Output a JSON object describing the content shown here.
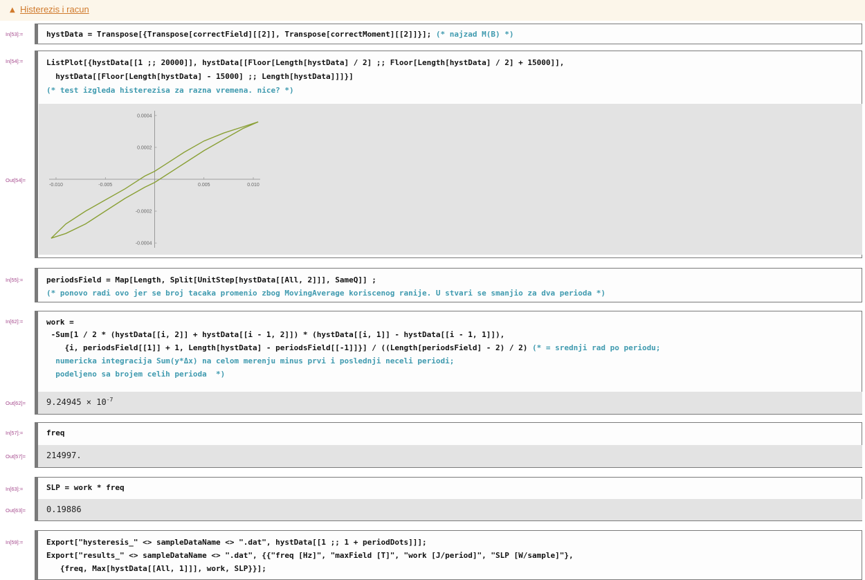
{
  "section": {
    "title": "Histerezis i racun"
  },
  "cells": {
    "c53": {
      "in_label": "In[53]:=",
      "line1": "hystData = Transpose[{Transpose[correctField][[2]], Transpose[correctMoment][[2]]}]; ",
      "comment": "(* najzad M(B) *)"
    },
    "c54": {
      "in_label": "In[54]:=",
      "out_label": "Out[54]=",
      "line1": "ListPlot[{hystData[[1 ;; 20000]], hystData[[Floor[Length[hystData] / 2] ;; Floor[Length[hystData] / 2] + 15000]],",
      "line2": "  hystData[[Floor[Length[hystData] - 15000] ;; Length[hystData]]]}]",
      "comment": "(* test izgleda histerezisa za razna vremena. nice? *)"
    },
    "c55": {
      "in_label": "In[55]:=",
      "line1": "periodsField = Map[Length, Split[UnitStep[hystData[[All, 2]]], SameQ]] ;",
      "comment": "(* ponovo radi ovo jer se broj tacaka promenio zbog MovingAverage koriscenog ranije. U stvari se smanjio za dva perioda *)"
    },
    "c62": {
      "in_label": "In[62]:=",
      "out_label": "Out[62]=",
      "line1": "work =",
      "line2": " -Sum[1 / 2 * (hystData[[i, 2]] + hystData[[i - 1, 2]]) * (hystData[[i, 1]] - hystData[[i - 1, 1]]),",
      "line3": "    {i, periodsField[[1]] + 1, Length[hystData] - periodsField[[-1]]}] / ((Length[periodsField] - 2) / 2) ",
      "line3_comment": "(* = srednji rad po periodu;",
      "line4": "  numericka integracija Sum(y*Δx) na celom merenju minus prvi i poslednji neceli periodi;",
      "line5": "  podeljeno sa brojem celih perioda  *)",
      "out_mantissa": "9.24945 × 10",
      "out_exp": "-7"
    },
    "c57": {
      "in_label": "In[57]:=",
      "out_label": "Out[57]=",
      "line1": "freq",
      "out": "214997."
    },
    "c63": {
      "in_label": "In[63]:=",
      "out_label": "Out[63]=",
      "line1": "SLP = work * freq",
      "out": "0.19886"
    },
    "c59": {
      "in_label": "In[59]:=",
      "line1": "Export[\"hysteresis_\" <> sampleDataName <> \".dat\", hystData[[1 ;; 1 + periodDots]]];",
      "line2": "Export[\"results_\" <> sampleDataName <> \".dat\", {{\"freq [Hz]\", \"maxField [T]\", \"work [J/period]\", \"SLP [W/sample]\"},",
      "line3": "   {freq, Max[hystData[[All, 1]]], work, SLP}}];"
    }
  },
  "chart_data": {
    "type": "scatter",
    "x_ticks": [
      "-0.010",
      "-0.005",
      "0.005",
      "0.010"
    ],
    "y_ticks": [
      "0.0004",
      "0.0002",
      "-0.0002",
      "-0.0004"
    ],
    "xlim": [
      -0.0107,
      0.0107
    ],
    "ylim": [
      -0.00043,
      0.00043
    ],
    "color": "#8aa036",
    "series": [
      {
        "x": [
          -0.0105,
          -0.009,
          -0.007,
          -0.005,
          -0.003,
          -0.001,
          0.0,
          0.001,
          0.003,
          0.005,
          0.007,
          0.009,
          0.0105
        ],
        "y": [
          -0.00037,
          -0.00034,
          -0.00028,
          -0.0002,
          -0.00012,
          -5e-05,
          -2e-05,
          2e-05,
          0.0001,
          0.00018,
          0.00025,
          0.00032,
          0.00036
        ]
      },
      {
        "x": [
          0.0105,
          0.009,
          0.007,
          0.005,
          0.003,
          0.001,
          0.0,
          -0.001,
          -0.003,
          -0.005,
          -0.007,
          -0.009,
          -0.0105
        ],
        "y": [
          0.00036,
          0.00033,
          0.00029,
          0.00024,
          0.00017,
          9e-05,
          5e-05,
          2e-05,
          -6e-05,
          -0.00013,
          -0.0002,
          -0.00028,
          -0.00037
        ]
      }
    ]
  }
}
